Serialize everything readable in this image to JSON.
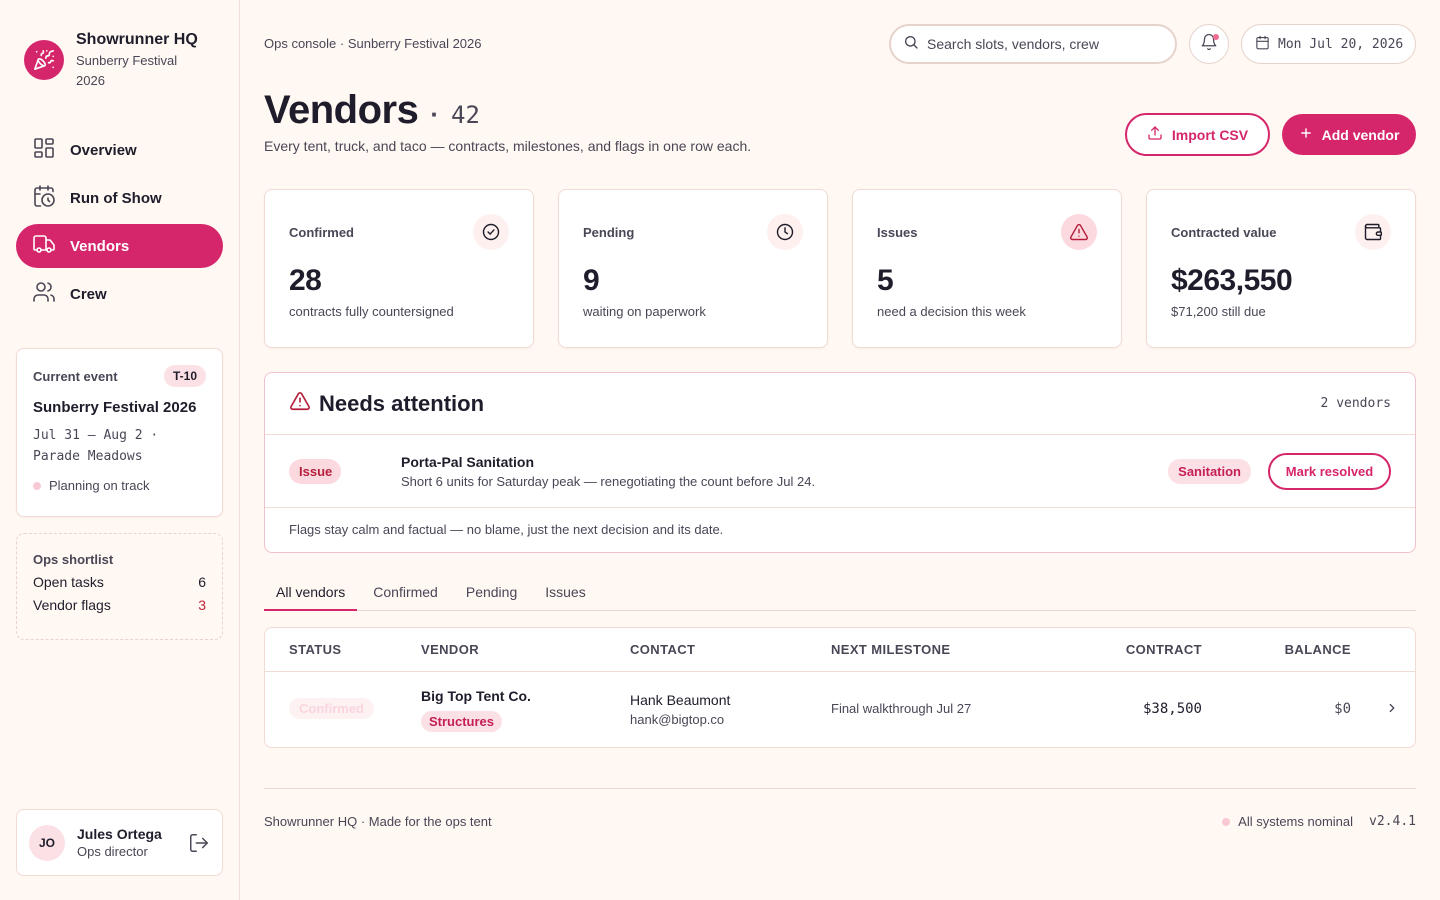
{
  "app": {
    "name": "Showrunner HQ",
    "event_subtitle": "Sunberry Festival 2026"
  },
  "nav": {
    "items": [
      {
        "label": "Overview",
        "icon": "grid-icon",
        "active": false
      },
      {
        "label": "Run of Show",
        "icon": "calendar-clock-icon",
        "active": false
      },
      {
        "label": "Vendors",
        "icon": "truck-icon",
        "active": true
      },
      {
        "label": "Crew",
        "icon": "users-icon",
        "active": false
      }
    ]
  },
  "current_event": {
    "label": "Current event",
    "badge": "T-10",
    "name": "Sunberry Festival 2026",
    "dates": "Jul 31 — Aug 2 ·",
    "venue": "Parade Meadows",
    "status": "Planning on track"
  },
  "shortlist": {
    "title": "Ops shortlist",
    "rows": [
      {
        "label": "Open tasks",
        "value": "6"
      },
      {
        "label": "Vendor flags",
        "value": "3"
      }
    ]
  },
  "user": {
    "initials": "JO",
    "name": "Jules Ortega",
    "role": "Ops director"
  },
  "header": {
    "breadcrumb": "Ops console · Sunberry Festival 2026",
    "search_placeholder": "Search slots, vendors, crew",
    "date": "Mon Jul 20, 2026"
  },
  "page": {
    "title": "Vendors",
    "separator": "·",
    "count": "42",
    "description": "Every tent, truck, and taco — contracts, milestones, and flags in one row each.",
    "import_label": "Import CSV",
    "add_label": "Add vendor"
  },
  "stats": [
    {
      "label": "Confirmed",
      "value": "28",
      "sub": "contracts fully countersigned",
      "icon": "check-circle-icon"
    },
    {
      "label": "Pending",
      "value": "9",
      "sub": "waiting on paperwork",
      "icon": "clock-icon"
    },
    {
      "label": "Issues",
      "value": "5",
      "sub": "need a decision this week",
      "icon": "alert-triangle-icon"
    },
    {
      "label": "Contracted value",
      "value": "$263,550",
      "sub": "$71,200 still due",
      "icon": "wallet-icon"
    }
  ],
  "attention": {
    "title": "Needs attention",
    "count": "2 vendors",
    "item": {
      "tag": "Issue",
      "vendor": "Porta-Pal Sanitation",
      "detail": "Short 6 units for Saturday peak — renegotiating the count before Jul 24.",
      "category": "Sanitation",
      "action": "Mark resolved"
    },
    "footnote": "Flags stay calm and factual — no blame, just the next decision and its date."
  },
  "tabs": [
    {
      "label": "All vendors",
      "active": true
    },
    {
      "label": "Confirmed",
      "active": false
    },
    {
      "label": "Pending",
      "active": false
    },
    {
      "label": "Issues",
      "active": false
    }
  ],
  "table": {
    "headers": {
      "status": "STATUS",
      "vendor": "VENDOR",
      "contact": "CONTACT",
      "milestone": "NEXT MILESTONE",
      "contract": "CONTRACT",
      "balance": "BALANCE"
    },
    "rows": [
      {
        "status": "Confirmed",
        "vendor": "Big Top Tent Co.",
        "category": "Structures",
        "contact_name": "Hank Beaumont",
        "contact_email": "hank@bigtop.co",
        "milestone": "Final walkthrough Jul 27",
        "contract": "$38,500",
        "balance": "$0"
      }
    ]
  },
  "footer": {
    "left": "Showrunner HQ · Made for the ops tent",
    "status": "All systems nominal",
    "version": "v2.4.1"
  },
  "colors": {
    "accent": "#d6266b",
    "background": "#fff8f3",
    "issue": "#b51f3c"
  }
}
